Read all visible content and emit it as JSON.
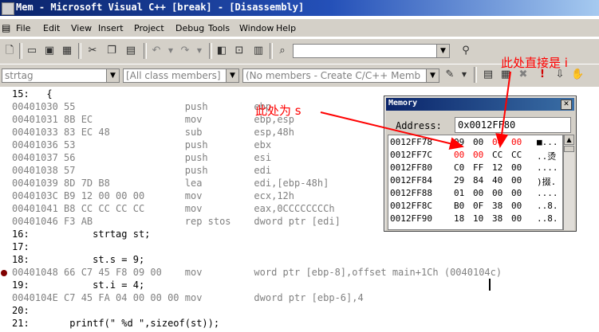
{
  "window": {
    "title": "Mem - Microsoft Visual C++ [break] - [Disassembly]"
  },
  "menu": [
    "File",
    "Edit",
    "View",
    "Insert",
    "Project",
    "Debug",
    "Tools",
    "Window",
    "Help"
  ],
  "toolbar": {
    "find_combo_value": "",
    "class_combo": "strtag",
    "members_combo": "[All class members]",
    "functions_combo": "(No members - Create C/C++ Memb"
  },
  "code_lines": [
    {
      "text": "15:   {",
      "kind": "src"
    },
    {
      "text": "00401030 55                   push        ebp",
      "kind": "dis"
    },
    {
      "text": "00401031 8B EC                mov         ebp,esp",
      "kind": "dis"
    },
    {
      "text": "00401033 83 EC 48             sub         esp,48h",
      "kind": "dis"
    },
    {
      "text": "00401036 53                   push        ebx",
      "kind": "dis"
    },
    {
      "text": "00401037 56                   push        esi",
      "kind": "dis"
    },
    {
      "text": "00401038 57                   push        edi",
      "kind": "dis"
    },
    {
      "text": "00401039 8D 7D B8             lea         edi,[ebp-48h]",
      "kind": "dis"
    },
    {
      "text": "0040103C B9 12 00 00 00       mov         ecx,12h",
      "kind": "dis"
    },
    {
      "text": "00401041 B8 CC CC CC CC       mov         eax,0CCCCCCCCh",
      "kind": "dis"
    },
    {
      "text": "00401046 F3 AB                rep stos    dword ptr [edi]",
      "kind": "dis"
    },
    {
      "text": "16:           strtag st;",
      "kind": "src"
    },
    {
      "text": "17:",
      "kind": "src"
    },
    {
      "text": "18:           st.s = 9;",
      "kind": "src"
    },
    {
      "text": "00401048 66 C7 45 F8 09 00    mov         word ptr [ebp-8],offset main+1Ch (0040104c)",
      "kind": "dis"
    },
    {
      "text": "19:           st.i = 4;",
      "kind": "src"
    },
    {
      "text": "0040104E C7 45 FA 04 00 00 00 mov         dword ptr [ebp-6],4",
      "kind": "dis"
    },
    {
      "text": "20:",
      "kind": "src"
    },
    {
      "text": "21:       printf(\" %d \",sizeof(st));",
      "kind": "src"
    }
  ],
  "memory": {
    "title": "Memory",
    "address_label": "Address:",
    "address_value": "0x0012FF80",
    "rows": [
      {
        "addr": "0012FF78",
        "bytes": [
          "09",
          "00",
          "04",
          "00"
        ],
        "red": [
          false,
          false,
          true,
          true
        ],
        "ascii": "■..."
      },
      {
        "addr": "0012FF7C",
        "bytes": [
          "00",
          "00",
          "CC",
          "CC"
        ],
        "red": [
          true,
          true,
          false,
          false
        ],
        "ascii": "..烫"
      },
      {
        "addr": "0012FF80",
        "bytes": [
          "C0",
          "FF",
          "12",
          "00"
        ],
        "red": [
          false,
          false,
          false,
          false
        ],
        "ascii": "...."
      },
      {
        "addr": "0012FF84",
        "bytes": [
          "29",
          "84",
          "40",
          "00"
        ],
        "red": [
          false,
          false,
          false,
          false
        ],
        "ascii": ")掇."
      },
      {
        "addr": "0012FF88",
        "bytes": [
          "01",
          "00",
          "00",
          "00"
        ],
        "red": [
          false,
          false,
          false,
          false
        ],
        "ascii": "...."
      },
      {
        "addr": "0012FF8C",
        "bytes": [
          "B0",
          "0F",
          "38",
          "00"
        ],
        "red": [
          false,
          false,
          false,
          false
        ],
        "ascii": "..8."
      },
      {
        "addr": "0012FF90",
        "bytes": [
          "18",
          "10",
          "38",
          "00"
        ],
        "red": [
          false,
          false,
          false,
          false
        ],
        "ascii": "..8."
      }
    ]
  },
  "annotations": {
    "note_i": "此处直接是 i",
    "note_s": "此处为 s"
  },
  "colors": {
    "annotation": "#ff0000",
    "breakpoint": "#800000",
    "title_bar": "#0a246a"
  }
}
